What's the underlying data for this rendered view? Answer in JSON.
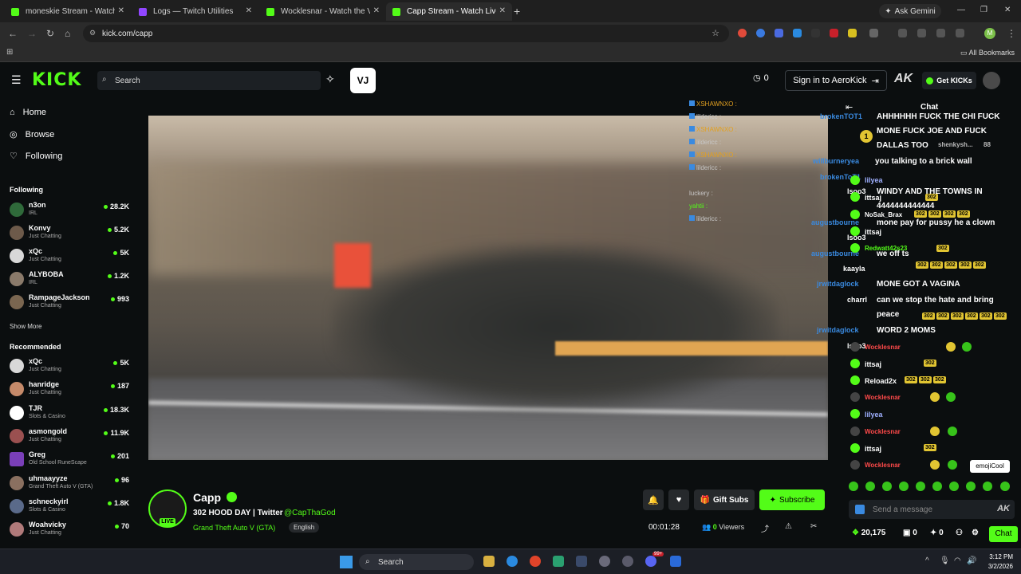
{
  "browser": {
    "tabs": [
      {
        "title": "moneskie Stream - Watch Live",
        "active": false,
        "color": "#53fc18"
      },
      {
        "title": "Logs — Twitch Utilities",
        "active": false,
        "color": "#9146ff"
      },
      {
        "title": "Wocklesnar - Watch the VOD o",
        "active": false,
        "color": "#53fc18"
      },
      {
        "title": "Capp Stream - Watch Live on K",
        "active": true,
        "color": "#53fc18"
      }
    ],
    "new_tab": "+",
    "gemini": "Ask Gemini",
    "url": "kick.com/capp",
    "all_bookmarks": "All Bookmarks",
    "profile_initial": "M"
  },
  "header": {
    "logo": "KICK",
    "search_placeholder": "Search",
    "notif_count": "0",
    "signin": "Sign in to AeroKick",
    "ak_logo": "AK",
    "get_kicks": "Get KICKs"
  },
  "sidebar": {
    "nav": [
      {
        "label": "Home",
        "icon": "home-icon"
      },
      {
        "label": "Browse",
        "icon": "compass-icon"
      },
      {
        "label": "Following",
        "icon": "heart-icon"
      }
    ],
    "following_title": "Following",
    "following": [
      {
        "name": "n3on",
        "category": "IRL",
        "viewers": "28.2K",
        "color": "#2f6a3a"
      },
      {
        "name": "Konvy",
        "category": "Just Chatting",
        "viewers": "5.2K",
        "color": "#6d5a4a"
      },
      {
        "name": "xQc",
        "category": "Just Chatting",
        "viewers": "5K",
        "color": "#d8d8d8"
      },
      {
        "name": "ALYBOBA",
        "category": "IRL",
        "viewers": "1.2K",
        "color": "#8a7a6a"
      },
      {
        "name": "RampageJackson",
        "category": "Just Chatting",
        "viewers": "993",
        "color": "#7a6650"
      }
    ],
    "show_more": "Show More",
    "recommended_title": "Recommended",
    "recommended": [
      {
        "name": "xQc",
        "category": "Just Chatting",
        "viewers": "5K",
        "color": "#d8d8d8"
      },
      {
        "name": "hanridge",
        "category": "Just Chatting",
        "viewers": "187",
        "color": "#c58a6a"
      },
      {
        "name": "TJR",
        "category": "Slots & Casino",
        "viewers": "18.3K",
        "color": "#ffffff"
      },
      {
        "name": "asmongold",
        "category": "Just Chatting",
        "viewers": "11.9K",
        "color": "#9a5050"
      },
      {
        "name": "Greg",
        "category": "Old School RuneScape",
        "viewers": "201",
        "color": "#7a3fb8"
      },
      {
        "name": "uhmaayyze",
        "category": "Grand Theft Auto V (GTA)",
        "viewers": "96",
        "color": "#8a7060"
      },
      {
        "name": "schneckyirl",
        "category": "Slots & Casino",
        "viewers": "1.8K",
        "color": "#5a6a8a"
      },
      {
        "name": "Woahvicky",
        "category": "Just Chatting",
        "viewers": "70",
        "color": "#b07a7a"
      }
    ]
  },
  "video_overlay_chat": [
    {
      "user": "XSHAWNXO :",
      "color": "#e2a020"
    },
    {
      "user": "lildericc :",
      "color": "#cfcfcf"
    },
    {
      "user": "XSHAWNXO :",
      "color": "#e2a020"
    },
    {
      "user": "lildericc :",
      "color": "#cfcfcf"
    },
    {
      "user": "XSHAWNXO :",
      "color": "#e2a020"
    },
    {
      "user": "lildericc :",
      "color": "#cfcfcf"
    },
    {
      "user": "luckery :",
      "color": "#cfcfcf"
    },
    {
      "user": "yahtii :",
      "color": "#53fc18"
    },
    {
      "user": "lildericc :",
      "color": "#cfcfcf"
    }
  ],
  "stream": {
    "name": "Capp",
    "title": "302 HOOD DAY | Twitter",
    "twitter": "@CapThaGod",
    "category": "Grand Theft Auto V (GTA)",
    "language": "English",
    "live_badge": "LIVE",
    "gift_subs": "Gift Subs",
    "subscribe": "Subscribe",
    "uptime": "00:01:28",
    "viewers_count": "0",
    "viewers_label": "Viewers"
  },
  "chat": {
    "title": "Chat",
    "overlay_messages": [
      "AHHHHHH FUCK THE CHI FUCK",
      "MONE FUCK JOE AND FUCK",
      "DALLAS TOO",
      "you talking to a brick wall",
      "WINDY AND THE TOWNS IN",
      "4444444444444",
      "mone pay for pussy he a clown",
      "we off ts",
      "MONE GOT A VAGINA",
      "can we stop the hate and bring",
      "peace",
      "WORD 2 MOMS"
    ],
    "overlay_users": [
      "brokenTOT1",
      "willburneryea",
      "brokenToT1",
      "lsoo3",
      "augustbourne",
      "lsoo3",
      "augustbourne",
      "kaayla",
      "jrwitdaglock",
      "charrl",
      "jrwitdaglock",
      "lsoo3"
    ],
    "users": [
      {
        "name": "lilyea",
        "color": "#9fb0ff"
      },
      {
        "name": "ittsaj",
        "color": "#ffffff"
      },
      {
        "name": "NoSak_Brax",
        "color": "#ffffff"
      },
      {
        "name": "ittsaj",
        "color": "#ffffff"
      },
      {
        "name": "Redwatt42s23",
        "color": "#53fc18"
      },
      {
        "name": "Wocklesnar",
        "color": "#ff4a4a"
      },
      {
        "name": "ittsaj",
        "color": "#ffffff"
      },
      {
        "name": "Reload2x",
        "color": "#ffffff"
      },
      {
        "name": "Wocklesnar",
        "color": "#ff4a4a"
      },
      {
        "name": "lilyea",
        "color": "#9fb0ff"
      },
      {
        "name": "Wocklesnar",
        "color": "#ff4a4a"
      },
      {
        "name": "ittsaj",
        "color": "#ffffff"
      },
      {
        "name": "Wocklesnar",
        "color": "#ff4a4a"
      }
    ],
    "pinned_user": "shenkysh...",
    "pinned_count": "88",
    "tag": "302",
    "tooltip": "emojiCool",
    "send_placeholder": "Send a message",
    "ak": "AK",
    "kicks": "20,175",
    "count_a": "0",
    "count_b": "0",
    "chat_button": "Chat"
  },
  "taskbar": {
    "search": "Search",
    "time": "3:12 PM",
    "date": "3/2/2026",
    "badge": "99+"
  }
}
